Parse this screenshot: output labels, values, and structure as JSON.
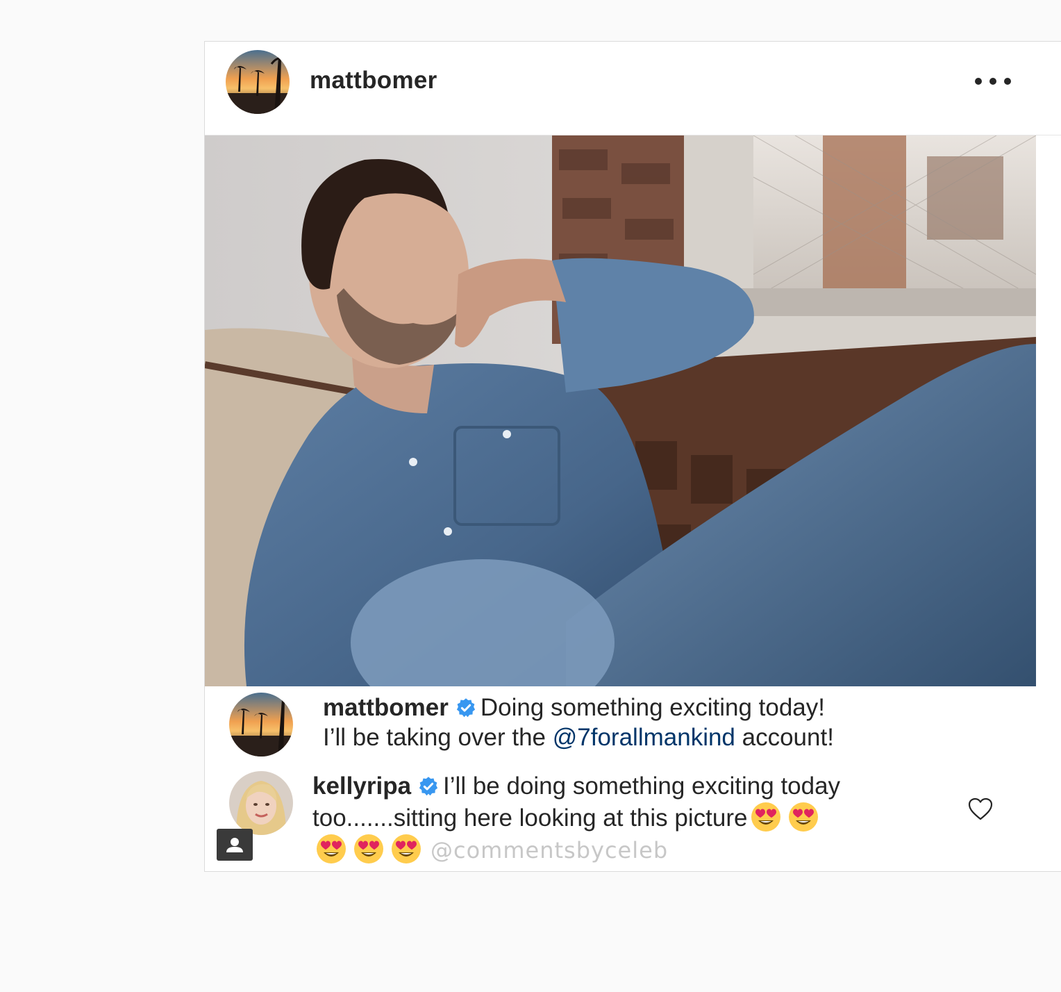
{
  "post": {
    "author": {
      "username": "mattbomer",
      "avatar_icon": "sunset-palm-avatar"
    },
    "menu_icon": "more-options-icon",
    "photo": {
      "description_icon": "post-photo"
    },
    "caption": {
      "username": "mattbomer",
      "verified_icon": "verified-badge-icon",
      "line1": "Doing something exciting today!",
      "line2_prefix": "I’ll be taking over the ",
      "mention": "@7forallmankind",
      "line2_suffix": " account!"
    },
    "comment": {
      "username": "kellyripa",
      "verified_icon": "verified-badge-icon",
      "line1": "I’ll be doing something exciting today",
      "line2": "too.......sitting here looking at this picture",
      "emoji_icon": "heart-eyes-emoji",
      "watermark": "@commentsbyceleb",
      "like_icon": "heart-outline-icon"
    },
    "profile_badge_icon": "person-icon"
  },
  "colors": {
    "page_bg": "#fafafa",
    "card_bg": "#ffffff",
    "border": "#dbdbdb",
    "text": "#262626",
    "mention": "#003569",
    "verified": "#3897f0",
    "watermark": "#c7c7c7"
  }
}
